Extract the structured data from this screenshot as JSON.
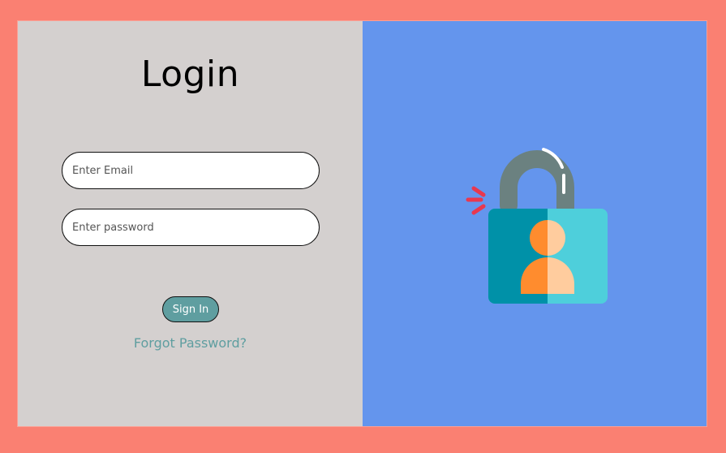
{
  "login": {
    "title": "Login",
    "email_placeholder": "Enter Email",
    "password_placeholder": "Enter password",
    "signin_label": "Sign In",
    "forgot_label": "Forgot Password?"
  },
  "illustration": {
    "icon": "padlock-user-icon"
  },
  "colors": {
    "page_background": "#fa8072",
    "left_panel": "#d4d0cf",
    "right_panel": "#6495ed",
    "accent": "#5f9ea0"
  }
}
